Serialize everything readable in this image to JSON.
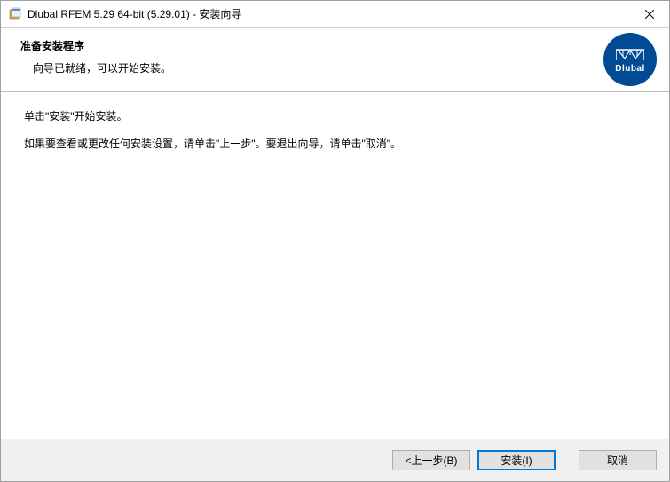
{
  "titlebar": {
    "title": "Dlubal RFEM 5.29 64-bit (5.29.01) - 安装向导"
  },
  "header": {
    "title": "准备安装程序",
    "subtitle": "向导已就绪，可以开始安装。"
  },
  "logo": {
    "text": "Dlubal"
  },
  "content": {
    "line1": "单击\"安装\"开始安装。",
    "line2": "如果要查看或更改任何安装设置，请单击\"上一步\"。要退出向导，请单击\"取消\"。"
  },
  "buttons": {
    "back": "<上一步(B)",
    "install": "安装(I)",
    "cancel": "取消"
  }
}
